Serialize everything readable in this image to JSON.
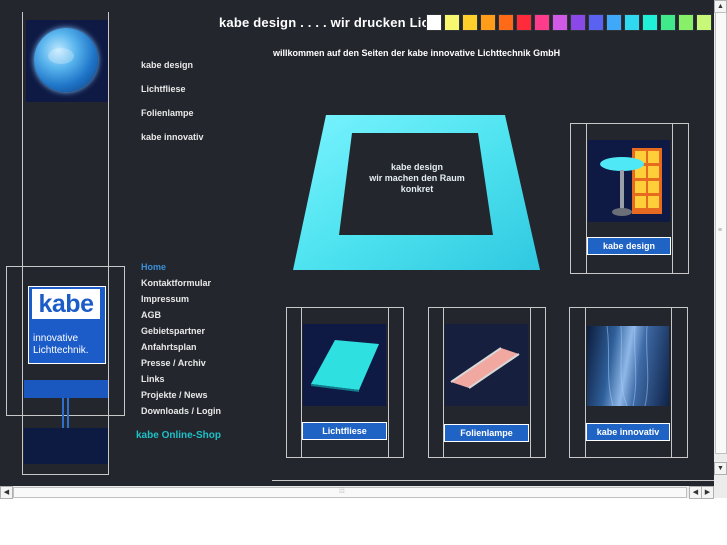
{
  "header": {
    "title": "kabe design . . . . wir drucken Licht",
    "welcome": "willkommen auf den Seiten der kabe innovative Lichttechnik GmbH",
    "swatch_colors": [
      "#ffffff",
      "#f8f870",
      "#ffcf2a",
      "#ff9d18",
      "#ff6a18",
      "#ff2a3a",
      "#ff3c8c",
      "#d05ae6",
      "#8a48e6",
      "#5a62f2",
      "#40a8f8",
      "#30d8f0",
      "#20f0d8",
      "#40ea8a",
      "#88f068",
      "#c8f878",
      "#ffffff"
    ]
  },
  "nav_top": [
    "kabe design",
    "Lichtfliese",
    "Folienlampe",
    "kabe innovativ"
  ],
  "nav_main": [
    "Home",
    "Kontaktformular",
    "Impressum",
    "AGB",
    "Gebietspartner",
    "Anfahrtsplan",
    "Presse / Archiv",
    "Links",
    "Projekte / News",
    "Downloads / Login"
  ],
  "active_nav": "Home",
  "shop_link": "kabe Online-Shop",
  "logo": {
    "word": "kabe",
    "line1": "innovative",
    "line2": "Lichttechnik."
  },
  "center": {
    "line1": "kabe design",
    "line2": "wir machen den Raum",
    "line3": "konkret"
  },
  "cards": {
    "design": "kabe design",
    "lichtfliese": "Lichtfliese",
    "folienlampe": "Folienlampe",
    "innovativ": "kabe innovativ"
  },
  "colors": {
    "background": "#23272d",
    "accent": "#1f63c4",
    "cyan": "#4fe6f2",
    "shop_link": "#1ec0c8"
  },
  "icons": [
    "globe-icon",
    "scroll-up-icon",
    "scroll-down-icon",
    "scroll-left-icon",
    "scroll-right-icon"
  ]
}
